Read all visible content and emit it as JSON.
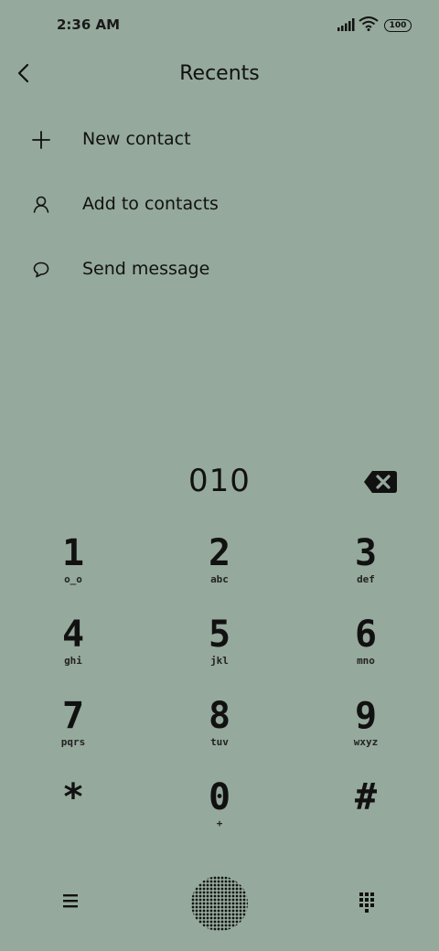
{
  "status_bar": {
    "time": "2:36 AM",
    "battery": "100"
  },
  "header": {
    "title": "Recents"
  },
  "actions": [
    {
      "label": "New contact",
      "icon": "plus-icon"
    },
    {
      "label": "Add to contacts",
      "icon": "person-icon"
    },
    {
      "label": "Send message",
      "icon": "message-bubble-icon"
    }
  ],
  "dialer": {
    "number": "010"
  },
  "keypad": [
    {
      "digit": "1",
      "sub": "o_o"
    },
    {
      "digit": "2",
      "sub": "abc"
    },
    {
      "digit": "3",
      "sub": "def"
    },
    {
      "digit": "4",
      "sub": "ghi"
    },
    {
      "digit": "5",
      "sub": "jkl"
    },
    {
      "digit": "6",
      "sub": "mno"
    },
    {
      "digit": "7",
      "sub": "pqrs"
    },
    {
      "digit": "8",
      "sub": "tuv"
    },
    {
      "digit": "9",
      "sub": "wxyz"
    },
    {
      "digit": "*",
      "sub": ""
    },
    {
      "digit": "0",
      "sub": "+"
    },
    {
      "digit": "#",
      "sub": ""
    }
  ]
}
